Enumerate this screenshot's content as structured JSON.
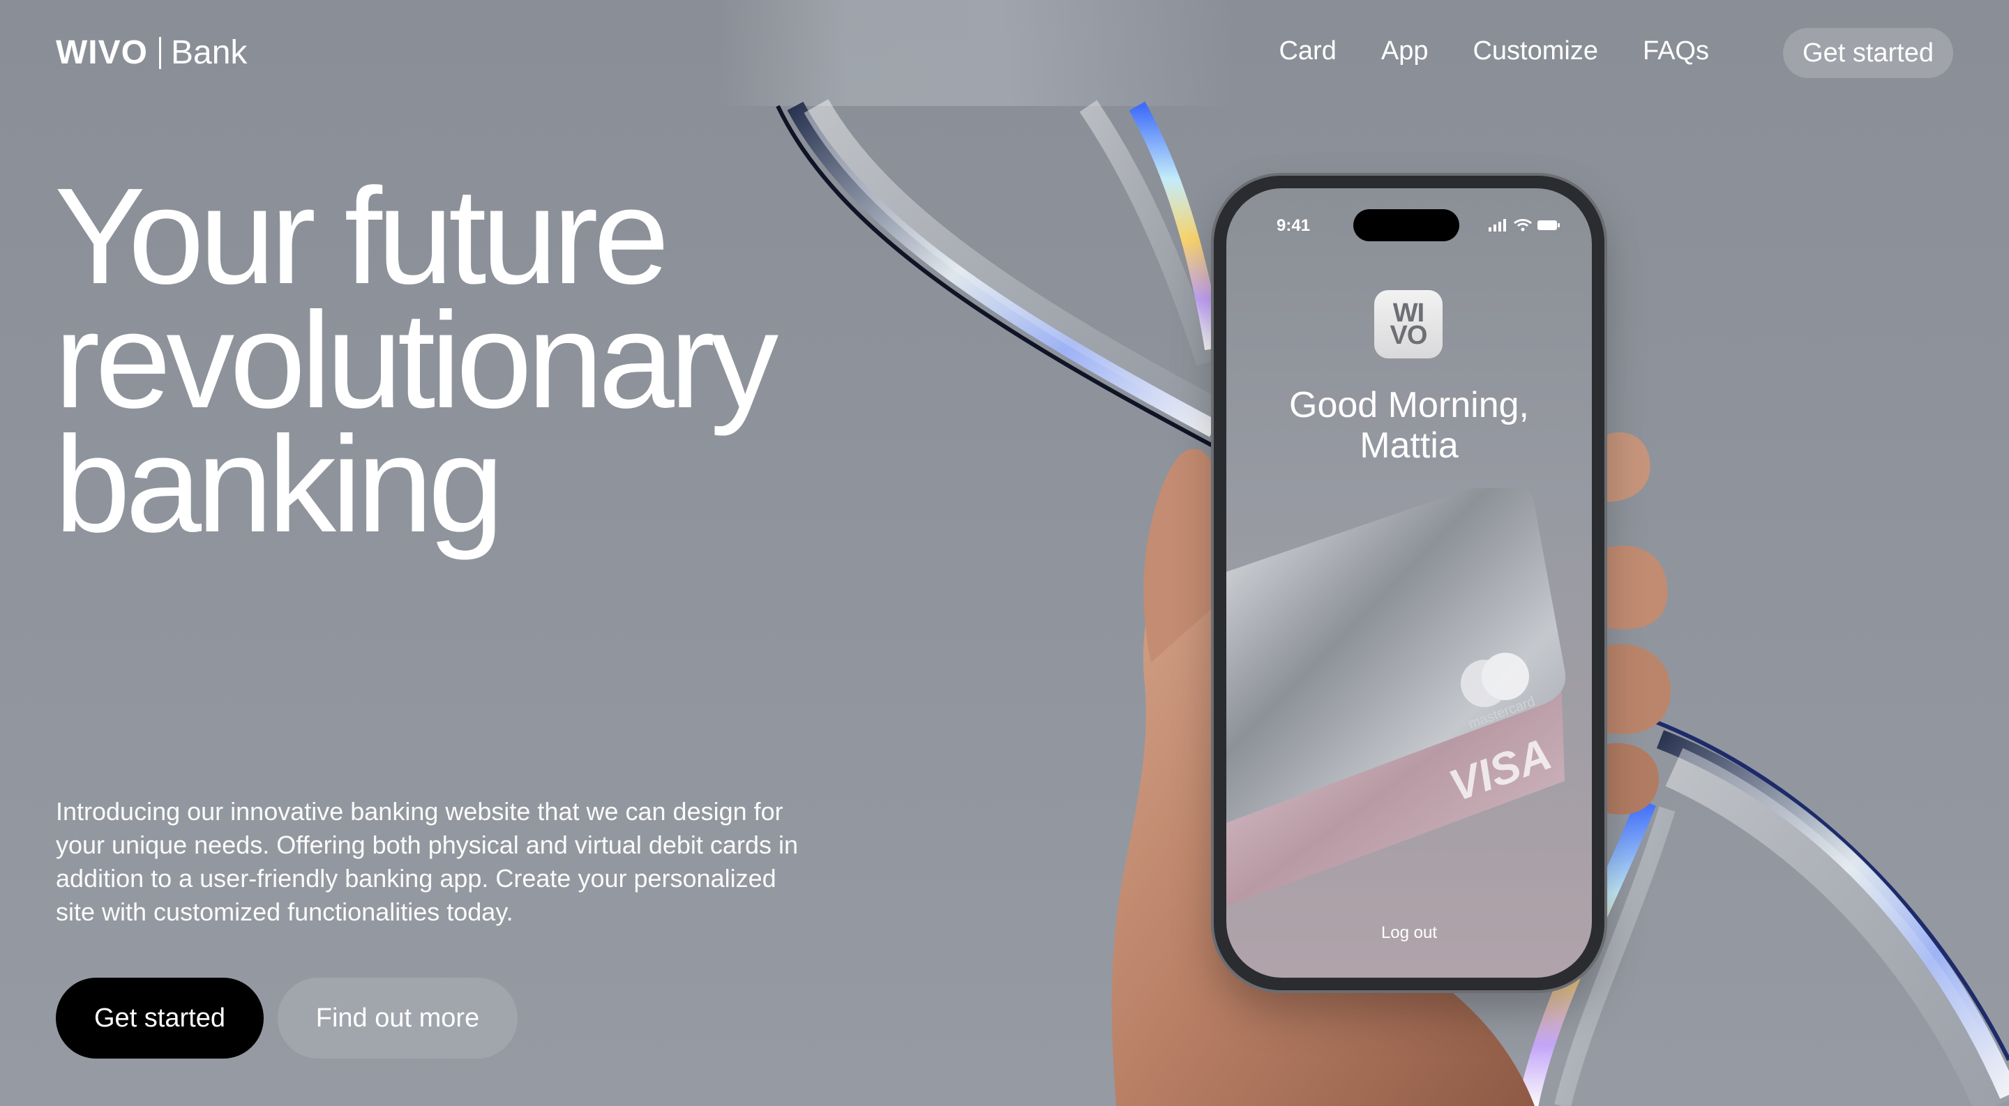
{
  "brand": {
    "name": "WIVO",
    "sub": "Bank"
  },
  "nav": {
    "links": [
      "Card",
      "App",
      "Customize",
      "FAQs"
    ],
    "cta": "Get started"
  },
  "hero": {
    "headline": [
      "Your future",
      "revolutionary",
      "banking"
    ],
    "intro": "Introducing our innovative banking website that we can design for your unique needs. Offering both physical and virtual debit cards in addition to a user-friendly banking app. Create your personalized site with customized functionalities today.",
    "primary_cta": "Get started",
    "secondary_cta": "Find out more"
  },
  "phone": {
    "time": "9:41",
    "app_icon": [
      "WI",
      "VO"
    ],
    "greeting": [
      "Good Morning,",
      "Mattia"
    ],
    "card_network_front": "mastercard",
    "card_network_back": "VISA",
    "logout": "Log out"
  },
  "colors": {
    "background": "#8f949c",
    "primary_button": "#000000",
    "text": "#ffffff"
  }
}
